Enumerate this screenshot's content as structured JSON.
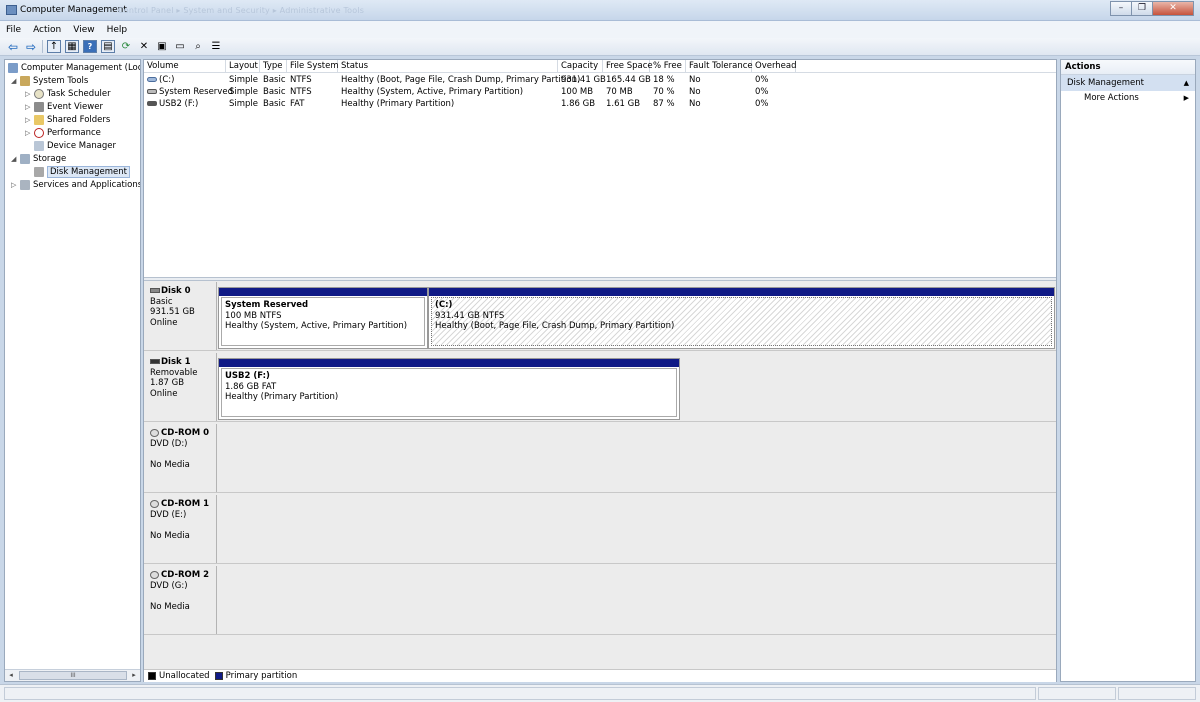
{
  "window": {
    "title": "Computer Management",
    "ghost_breadcrumb": "Control Panel ▸ System and Security ▸ Administrative Tools"
  },
  "menu": [
    "File",
    "Action",
    "View",
    "Help"
  ],
  "tree": [
    {
      "label": "Computer Management (Local",
      "icon": "computer-icon",
      "exp": ""
    },
    {
      "label": "System Tools",
      "icon": "tools-icon",
      "exp": "◢"
    },
    {
      "label": "Task Scheduler",
      "icon": "clock-icon",
      "exp": "▷"
    },
    {
      "label": "Event Viewer",
      "icon": "event-viewer-icon",
      "exp": "▷"
    },
    {
      "label": "Shared Folders",
      "icon": "folder-icon",
      "exp": "▷"
    },
    {
      "label": "Performance",
      "icon": "performance-icon",
      "exp": "▷"
    },
    {
      "label": "Device Manager",
      "icon": "device-manager-icon",
      "exp": ""
    },
    {
      "label": "Storage",
      "icon": "storage-icon",
      "exp": "◢"
    },
    {
      "label": "Disk Management",
      "icon": "disk-management-icon",
      "exp": ""
    },
    {
      "label": "Services and Applications",
      "icon": "services-icon",
      "exp": "▷"
    }
  ],
  "volume_columns": [
    "Volume",
    "Layout",
    "Type",
    "File System",
    "Status",
    "Capacity",
    "Free Space",
    "% Free",
    "Fault Tolerance",
    "Overhead"
  ],
  "volumes": [
    [
      "(C:)",
      "Simple",
      "Basic",
      "NTFS",
      "Healthy (Boot, Page File, Crash Dump, Primary Partition)",
      "931.41 GB",
      "165.44 GB",
      "18 %",
      "No",
      "0%"
    ],
    [
      "System Reserved",
      "Simple",
      "Basic",
      "NTFS",
      "Healthy (System, Active, Primary Partition)",
      "100 MB",
      "70 MB",
      "70 %",
      "No",
      "0%"
    ],
    [
      "USB2 (F:)",
      "Simple",
      "Basic",
      "FAT",
      "Healthy (Primary Partition)",
      "1.86 GB",
      "1.61 GB",
      "87 %",
      "No",
      "0%"
    ]
  ],
  "disks": [
    {
      "name": "Disk 0",
      "line2": "Basic",
      "line3": "931.51 GB",
      "line4": "Online",
      "partitions": [
        {
          "name": "System Reserved",
          "size": "100 MB NTFS",
          "status": "Healthy (System, Active, Primary Partition)"
        },
        {
          "name": "(C:)",
          "size": "931.41 GB NTFS",
          "status": "Healthy (Boot, Page File, Crash Dump, Primary Partition)"
        }
      ]
    },
    {
      "name": "Disk 1",
      "line2": "Removable",
      "line3": "1.87 GB",
      "line4": "Online",
      "partitions": [
        {
          "name": "USB2  (F:)",
          "size": "1.86 GB FAT",
          "status": "Healthy (Primary Partition)"
        }
      ]
    },
    {
      "name": "CD-ROM 0",
      "line2": "DVD (D:)",
      "line3": "",
      "line4": "No Media",
      "partitions": []
    },
    {
      "name": "CD-ROM 1",
      "line2": "DVD (E:)",
      "line3": "",
      "line4": "No Media",
      "partitions": []
    },
    {
      "name": "CD-ROM 2",
      "line2": "DVD (G:)",
      "line3": "",
      "line4": "No Media",
      "partitions": []
    }
  ],
  "legend": [
    {
      "label": "Unallocated",
      "color": "#000000"
    },
    {
      "label": "Primary partition",
      "color": "#101a86"
    }
  ],
  "actions": {
    "header": "Actions",
    "section": "Disk Management",
    "more": "More Actions"
  }
}
